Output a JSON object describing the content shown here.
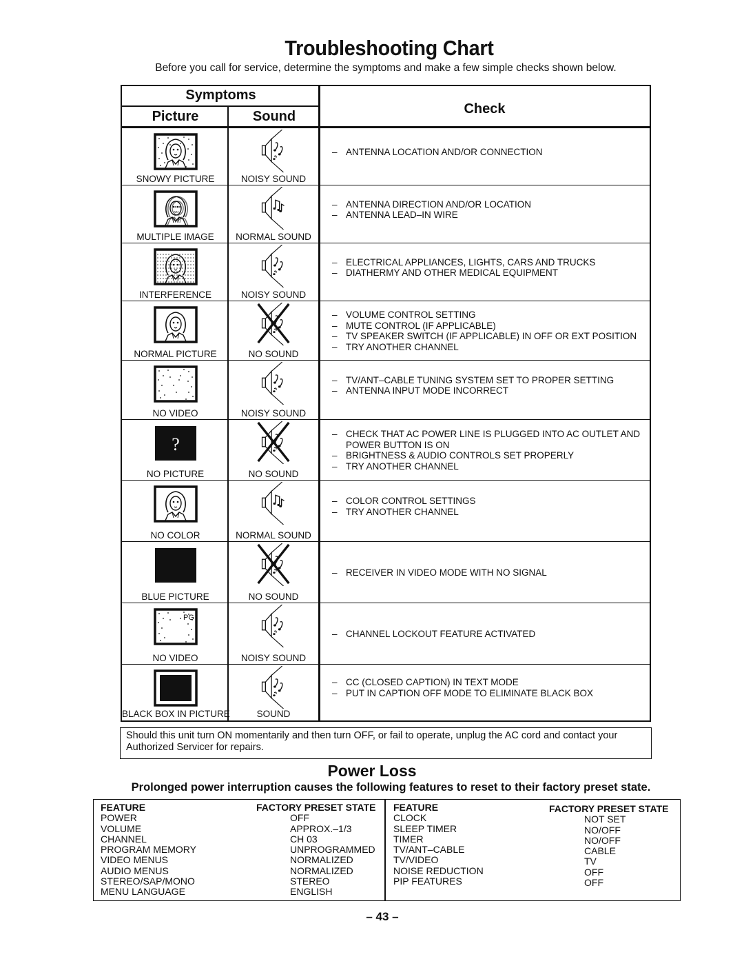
{
  "title": "Troubleshooting Chart",
  "subtitle": "Before you call for service, determine the symptoms and make a few simple checks shown below.",
  "table": {
    "header_symptoms": "Symptoms",
    "header_picture": "Picture",
    "header_sound": "Sound",
    "header_check": "Check",
    "rows": [
      {
        "picture": "SNOWY PICTURE",
        "picture_icon": "snowy-tv-icon",
        "sound": "NOISY SOUND",
        "sound_icon": "noisy-speaker-icon",
        "checks": [
          "ANTENNA LOCATION AND/OR CONNECTION"
        ]
      },
      {
        "picture": "MULTIPLE IMAGE",
        "picture_icon": "multiple-image-tv-icon",
        "sound": "NORMAL SOUND",
        "sound_icon": "normal-speaker-icon",
        "checks": [
          "ANTENNA DIRECTION AND/OR LOCATION",
          "ANTENNA LEAD–IN WIRE"
        ]
      },
      {
        "picture": "INTERFERENCE",
        "picture_icon": "interference-tv-icon",
        "sound": "NOISY SOUND",
        "sound_icon": "noisy-speaker-icon",
        "checks": [
          "ELECTRICAL APPLIANCES, LIGHTS, CARS AND TRUCKS",
          "DIATHERMY AND OTHER MEDICAL EQUIPMENT"
        ]
      },
      {
        "picture": "NORMAL PICTURE",
        "picture_icon": "normal-tv-icon",
        "sound": "NO SOUND",
        "sound_icon": "muted-speaker-icon",
        "checks": [
          "VOLUME CONTROL SETTING",
          "MUTE CONTROL (IF APPLICABLE)",
          "TV SPEAKER SWITCH (IF APPLICABLE) IN OFF OR EXT  POSITION",
          "TRY ANOTHER CHANNEL"
        ]
      },
      {
        "picture": "NO VIDEO",
        "picture_icon": "static-tv-icon",
        "sound": "NOISY SOUND",
        "sound_icon": "noisy-speaker-icon",
        "checks": [
          "TV/ANT–CABLE TUNING SYSTEM SET TO PROPER SETTING",
          "ANTENNA INPUT MODE INCORRECT"
        ]
      },
      {
        "picture": "NO PICTURE",
        "picture_icon": "question-tv-icon",
        "sound": "NO SOUND",
        "sound_icon": "muted-speaker-icon",
        "checks": [
          "CHECK THAT AC POWER LINE  IS PLUGGED  INTO AC OUTLET AND POWER BUTTON IS ON",
          "BRIGHTNESS & AUDIO CONTROLS SET PROPERLY",
          "TRY ANOTHER CHANNEL"
        ]
      },
      {
        "picture": "NO COLOR",
        "picture_icon": "normal-tv-icon",
        "sound": "NORMAL SOUND",
        "sound_icon": "normal-speaker-icon",
        "checks": [
          "COLOR CONTROL SETTINGS",
          "TRY ANOTHER CHANNEL"
        ]
      },
      {
        "picture": "BLUE PICTURE",
        "picture_icon": "blank-screen-icon",
        "sound": "NO SOUND",
        "sound_icon": "muted-speaker-icon",
        "checks": [
          "RECEIVER IN VIDEO MODE WITH NO SIGNAL"
        ]
      },
      {
        "picture": "NO VIDEO",
        "picture_icon": "pg-static-tv-icon",
        "sound": "NOISY SOUND",
        "sound_icon": "noisy-speaker-icon",
        "pg_label": "PG",
        "checks": [
          "CHANNEL LOCKOUT FEATURE ACTIVATED"
        ]
      },
      {
        "picture": "BLACK BOX IN PICTURE",
        "picture_icon": "black-box-tv-icon",
        "sound": "SOUND",
        "sound_icon": "noisy-speaker-icon",
        "checks": [
          "CC (CLOSED CAPTION) IN TEXT MODE",
          "PUT IN CAPTION OFF MODE TO ELIMINATE BLACK BOX"
        ]
      }
    ]
  },
  "note": "Should this unit turn ON momentarily and then turn OFF, or fail to operate, unplug the AC cord and contact your Authorized Servicer for repairs.",
  "power_loss": {
    "title": "Power Loss",
    "subtitle": "Prolonged power interruption causes the following features to reset to their factory preset state.",
    "header_feature": "FEATURE",
    "header_state": "FACTORY PRESET STATE",
    "left": [
      {
        "feature": "POWER",
        "state": "OFF"
      },
      {
        "feature": "VOLUME",
        "state": "APPROX.–1/3"
      },
      {
        "feature": "CHANNEL",
        "state": "CH 03"
      },
      {
        "feature": "PROGRAM MEMORY",
        "state": "UNPROGRAMMED"
      },
      {
        "feature": "VIDEO MENUS",
        "state": "NORMALIZED"
      },
      {
        "feature": "AUDIO MENUS",
        "state": "NORMALIZED"
      },
      {
        "feature": "STEREO/SAP/MONO",
        "state": "STEREO"
      },
      {
        "feature": "MENU LANGUAGE",
        "state": "ENGLISH"
      }
    ],
    "right": [
      {
        "feature": "CLOCK",
        "state": "NOT SET"
      },
      {
        "feature": "SLEEP TIMER",
        "state": "NO/OFF"
      },
      {
        "feature": "TIMER",
        "state": "NO/OFF"
      },
      {
        "feature": "TV/ANT–CABLE",
        "state": "CABLE"
      },
      {
        "feature": "TV/VIDEO",
        "state": "TV"
      },
      {
        "feature": "NOISE REDUCTION",
        "state": "OFF"
      },
      {
        "feature": "PIP FEATURES",
        "state": "OFF"
      }
    ]
  },
  "page_number": "– 43 –"
}
